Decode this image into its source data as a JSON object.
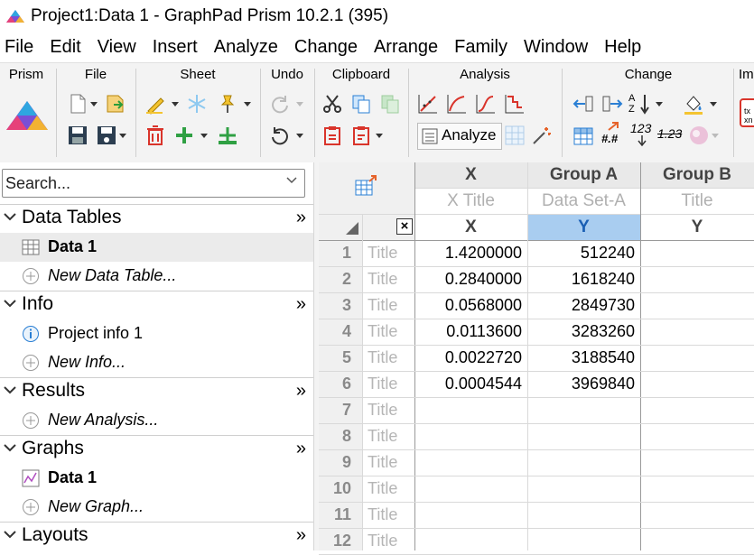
{
  "window": {
    "title": "Project1:Data 1 - GraphPad Prism 10.2.1 (395)"
  },
  "menu": [
    "File",
    "Edit",
    "View",
    "Insert",
    "Analyze",
    "Change",
    "Arrange",
    "Family",
    "Window",
    "Help"
  ],
  "ribbon": {
    "groups": [
      "Prism",
      "File",
      "Sheet",
      "Undo",
      "Clipboard",
      "Analysis",
      "Change",
      "Im"
    ],
    "analyze_label": "Analyze",
    "num_label_1": "123",
    "num_label_2": "1.23",
    "sort_label": "A Z",
    "hash_label": "#.#"
  },
  "navigator": {
    "search_placeholder": "Search...",
    "sections": {
      "data_tables": {
        "label": "Data Tables",
        "items": [
          "Data 1",
          "New Data Table..."
        ]
      },
      "info": {
        "label": "Info",
        "items": [
          "Project info 1",
          "New Info..."
        ]
      },
      "results": {
        "label": "Results",
        "items": [
          "New Analysis..."
        ]
      },
      "graphs": {
        "label": "Graphs",
        "items": [
          "Data 1",
          "New Graph..."
        ]
      },
      "layouts": {
        "label": "Layouts"
      }
    },
    "expand_glyph": "»"
  },
  "table": {
    "columns": [
      {
        "group": "X",
        "title": "X Title",
        "sub": "X"
      },
      {
        "group": "Group A",
        "title": "Data Set-A",
        "sub": "Y"
      },
      {
        "group": "Group B",
        "title": "Title",
        "sub": "Y"
      }
    ],
    "row_title_placeholder": "Title",
    "close_glyph": "×",
    "rows": [
      {
        "n": "1",
        "x": "1.4200000",
        "a": "512240"
      },
      {
        "n": "2",
        "x": "0.2840000",
        "a": "1618240"
      },
      {
        "n": "3",
        "x": "0.0568000",
        "a": "2849730"
      },
      {
        "n": "4",
        "x": "0.0113600",
        "a": "3283260"
      },
      {
        "n": "5",
        "x": "0.0022720",
        "a": "3188540"
      },
      {
        "n": "6",
        "x": "0.0004544",
        "a": "3969840"
      },
      {
        "n": "7",
        "x": "",
        "a": ""
      },
      {
        "n": "8",
        "x": "",
        "a": ""
      },
      {
        "n": "9",
        "x": "",
        "a": ""
      },
      {
        "n": "10",
        "x": "",
        "a": ""
      },
      {
        "n": "11",
        "x": "",
        "a": ""
      },
      {
        "n": "12",
        "x": "",
        "a": ""
      }
    ]
  }
}
